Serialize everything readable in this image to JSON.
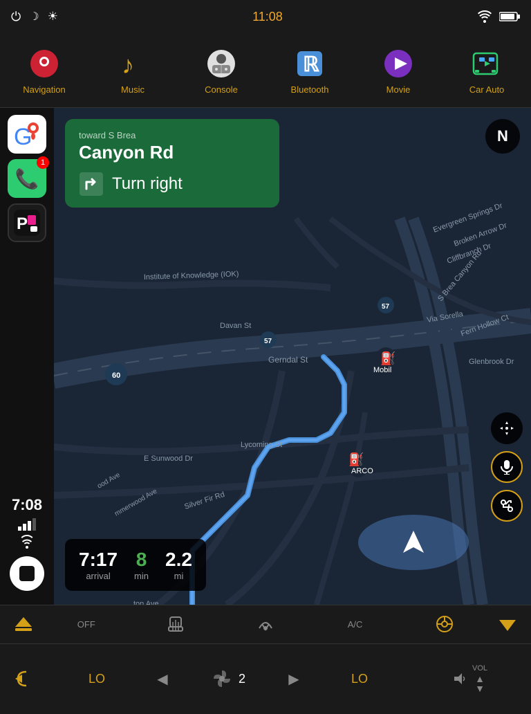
{
  "status": {
    "time": "11:08",
    "power_icon": "⏻",
    "moon_icon": "☾",
    "brightness_icon": "☀",
    "wifi_icon": "wifi",
    "battery_icon": "battery"
  },
  "navbar": {
    "items": [
      {
        "id": "navigation",
        "label": "Navigation",
        "icon": "nav"
      },
      {
        "id": "music",
        "label": "Music",
        "icon": "music"
      },
      {
        "id": "console",
        "label": "Console",
        "icon": "console"
      },
      {
        "id": "bluetooth",
        "label": "Bluetooth",
        "icon": "bluetooth"
      },
      {
        "id": "movie",
        "label": "Movie",
        "icon": "movie"
      },
      {
        "id": "carauto",
        "label": "Car Auto",
        "icon": "carauto"
      }
    ]
  },
  "sidebar": {
    "apps": [
      {
        "id": "maps",
        "icon": "maps",
        "badge": null
      },
      {
        "id": "phone",
        "icon": "phone",
        "badge": "1"
      },
      {
        "id": "picsart",
        "icon": "picsart",
        "badge": null
      }
    ],
    "time": "7:08"
  },
  "map": {
    "compass": "N",
    "nav_card": {
      "toward": "toward S Brea",
      "street": "Canyon Rd",
      "instruction": "Turn right"
    },
    "trip": {
      "arrival": "7:17",
      "arrival_label": "arrival",
      "minutes": "8",
      "minutes_label": "min",
      "distance": "2.2",
      "distance_label": "mi"
    }
  },
  "bottom": {
    "top_row": {
      "off_label": "OFF",
      "seat_label": "",
      "fan_dir_label": "",
      "ac_label": "A/C",
      "steering_label": "",
      "eject_label": ""
    },
    "main_row": {
      "left_temp": "LO",
      "fan_count": "2",
      "right_temp": "LO",
      "vol_label": "VOL"
    }
  }
}
